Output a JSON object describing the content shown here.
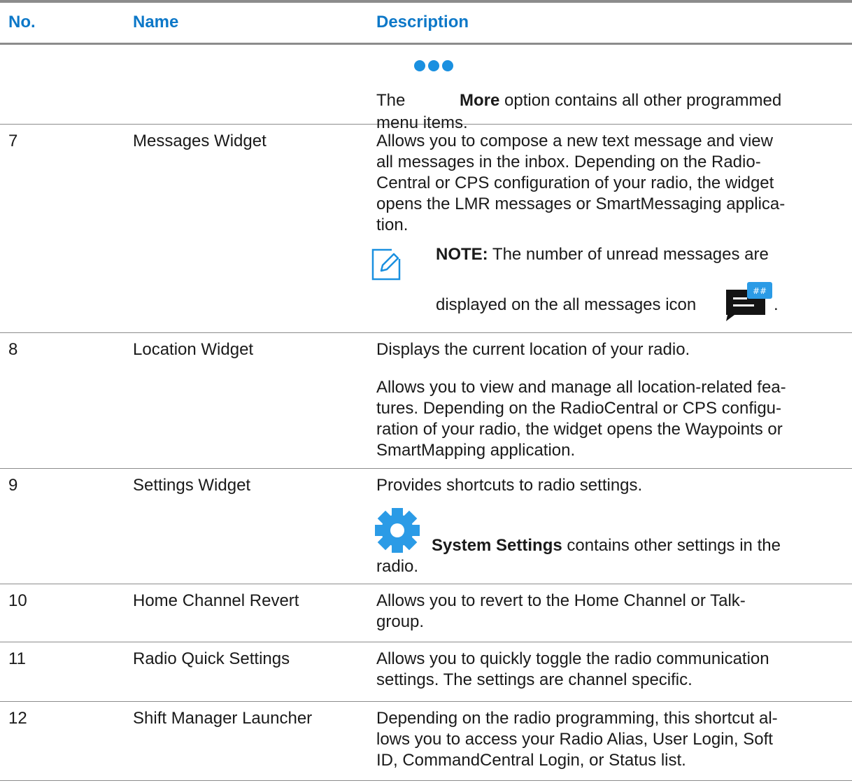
{
  "header": {
    "no": "No.",
    "name": "Name",
    "description": "Description"
  },
  "rows": [
    {
      "no": "",
      "name": "",
      "desc": {
        "pre_icon": "The",
        "icon": "more-dots-icon",
        "bold": "More",
        "line1_rest": "option contains all other programmed",
        "line2": "menu items."
      }
    },
    {
      "no": "7",
      "name": "Messages Widget",
      "desc": {
        "lines": [
          "Allows you to compose a new text message and view",
          "all messages in the inbox. Depending on the Radio-",
          "Central or CPS configuration of your radio, the widget",
          "opens the LMR messages or SmartMessaging applica-",
          "tion."
        ],
        "note_icon": "note-pencil-icon",
        "note_label": "NOTE:",
        "note_line1": "The number of unread messages are",
        "note_line2": "displayed on the all messages icon",
        "note_end": ".",
        "messages_icon": "messages-icon"
      }
    },
    {
      "no": "8",
      "name": "Location Widget",
      "desc": {
        "p1": "Displays the current location of your radio.",
        "lines": [
          "Allows you to view and manage all location-related fea-",
          "tures. Depending on the RadioCentral or CPS configu-",
          "ration of your radio, the widget opens the Waypoints or",
          "SmartMapping application."
        ]
      }
    },
    {
      "no": "9",
      "name": "Settings Widget",
      "desc": {
        "p1": "Provides shortcuts to radio settings.",
        "icon": "gear-icon",
        "bold": "System Settings",
        "line1_rest": "contains other settings in the",
        "line2": "radio."
      }
    },
    {
      "no": "10",
      "name": "Home Channel Revert",
      "desc": {
        "lines": [
          "Allows you to revert to the Home Channel or Talk-",
          "group."
        ]
      }
    },
    {
      "no": "11",
      "name": "Radio Quick Settings",
      "desc": {
        "lines": [
          "Allows you to quickly toggle the radio communication",
          "settings. The settings are channel specific."
        ]
      }
    },
    {
      "no": "12",
      "name": "Shift Manager Launcher",
      "desc": {
        "lines": [
          "Depending on the radio programming, this shortcut al-",
          "lows you to access your Radio Alias, User Login, Soft",
          "ID, CommandCentral Login, or Status list."
        ]
      }
    }
  ],
  "colors": {
    "header_text": "#0d78c8",
    "icon_blue": "#1a90e0",
    "rule": "#8c8c8c"
  }
}
